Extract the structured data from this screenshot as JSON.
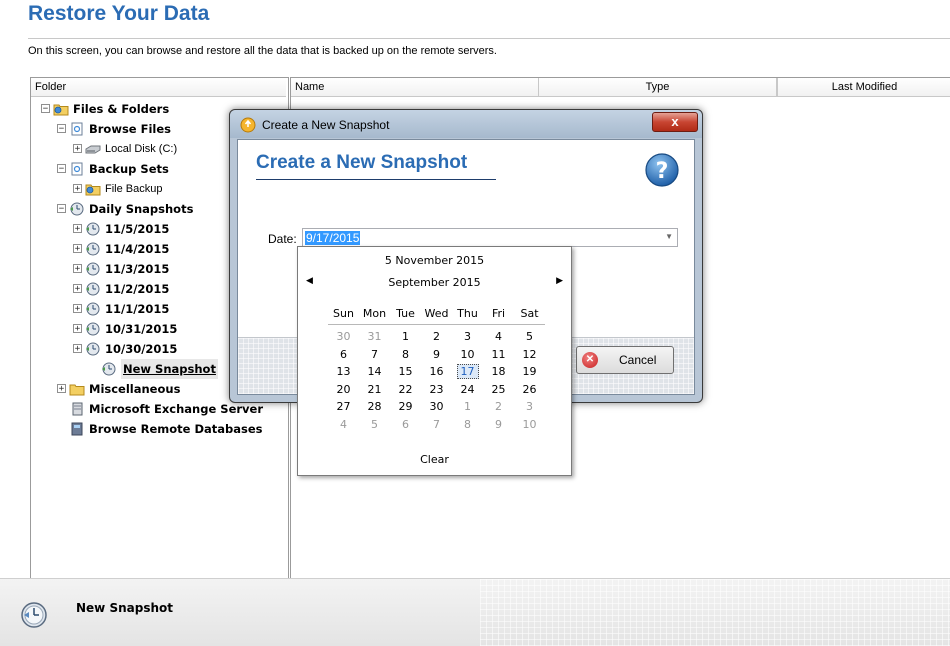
{
  "header": {
    "title": "Restore Your Data",
    "subtitle": "On this screen, you can browse and restore all the data that is backed up on the remote servers."
  },
  "folder_panel": {
    "column": "Folder",
    "tree": [
      {
        "label": "Files & Folders",
        "bold": true
      },
      {
        "label": "Browse Files",
        "bold": true
      },
      {
        "label": "Local Disk (C:)",
        "bold": false
      },
      {
        "label": "Backup Sets",
        "bold": true
      },
      {
        "label": "File Backup",
        "bold": false
      },
      {
        "label": "Daily Snapshots",
        "bold": true
      },
      {
        "label": "11/5/2015",
        "bold": true
      },
      {
        "label": "11/4/2015",
        "bold": true
      },
      {
        "label": "11/3/2015",
        "bold": true
      },
      {
        "label": "11/2/2015",
        "bold": true
      },
      {
        "label": "11/1/2015",
        "bold": true
      },
      {
        "label": "10/31/2015",
        "bold": true
      },
      {
        "label": "10/30/2015",
        "bold": true
      },
      {
        "label": "New Snapshot",
        "bold": true,
        "selected": true
      },
      {
        "label": "Miscellaneous",
        "bold": true
      },
      {
        "label": "Microsoft Exchange Server",
        "bold": true
      },
      {
        "label": "Browse Remote Databases",
        "bold": true
      }
    ]
  },
  "content_panel": {
    "columns": [
      "Name",
      "Type",
      "Last Modified"
    ]
  },
  "dialog": {
    "window_title": "Create a New Snapshot",
    "close_label": "x",
    "heading": "Create a New Snapshot",
    "date_label": "Date:",
    "date_value": "9/17/2015",
    "cancel_label": "Cancel"
  },
  "calendar": {
    "today_label": "5 November 2015",
    "month_label": "September 2015",
    "weekdays": [
      "Sun",
      "Mon",
      "Tue",
      "Wed",
      "Thu",
      "Fri",
      "Sat"
    ],
    "weeks": [
      [
        "30",
        "31",
        "1",
        "2",
        "3",
        "4",
        "5"
      ],
      [
        "6",
        "7",
        "8",
        "9",
        "10",
        "11",
        "12"
      ],
      [
        "13",
        "14",
        "15",
        "16",
        "17",
        "18",
        "19"
      ],
      [
        "20",
        "21",
        "22",
        "23",
        "24",
        "25",
        "26"
      ],
      [
        "27",
        "28",
        "29",
        "30",
        "1",
        "2",
        "3"
      ],
      [
        "4",
        "5",
        "6",
        "7",
        "8",
        "9",
        "10"
      ]
    ],
    "selected_day": "17",
    "clear_label": "Clear"
  },
  "status": {
    "text": "New Snapshot"
  },
  "colors": {
    "accent": "#2b6cb4",
    "selection": "#3399ff"
  },
  "icons": {
    "help": "help-question-icon",
    "snapshot": "clock-snapshot-icon",
    "folder": "folder-icon",
    "close": "close-icon"
  }
}
